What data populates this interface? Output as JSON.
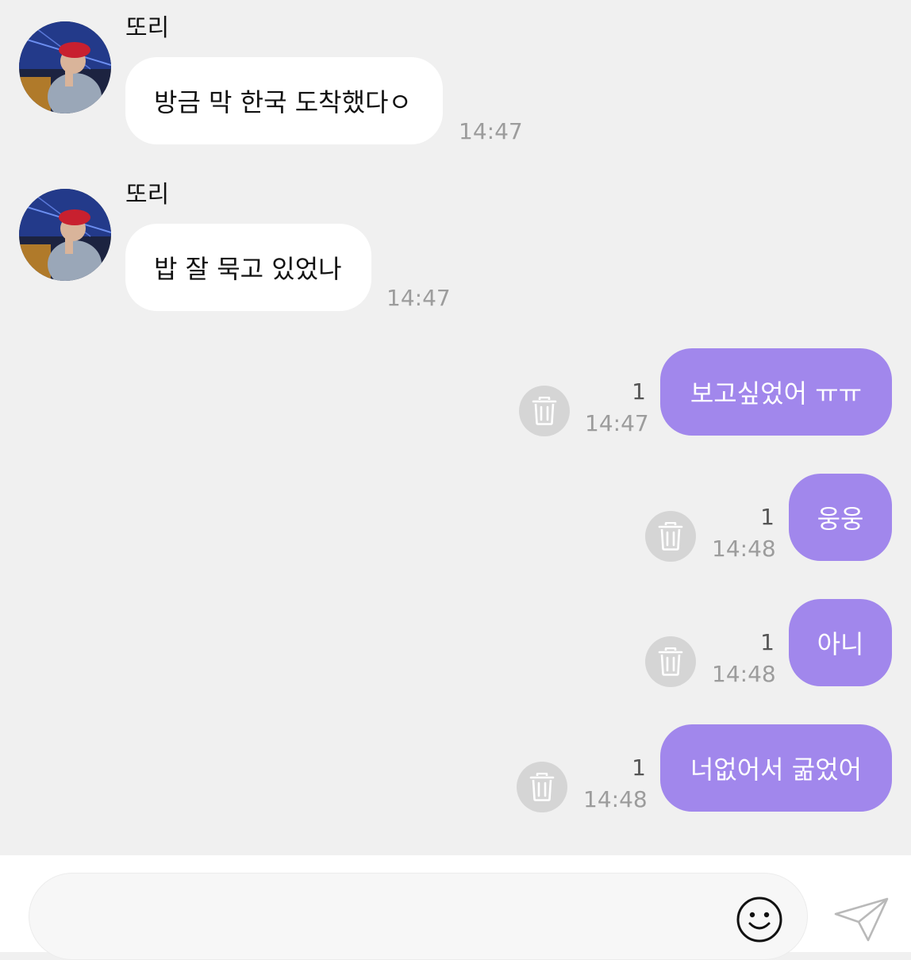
{
  "conversation": {
    "incoming": [
      {
        "sender": "또리",
        "text": "방금 막 한국 도착했다ㅇ",
        "time": "14:47"
      },
      {
        "sender": "또리",
        "text": "밥 잘 묵고 있었나",
        "time": "14:47"
      }
    ],
    "outgoing": [
      {
        "text": "보고싶었어 ㅠㅠ",
        "time": "14:47",
        "unread": "1"
      },
      {
        "text": "웅웅",
        "time": "14:48",
        "unread": "1"
      },
      {
        "text": "아니",
        "time": "14:48",
        "unread": "1"
      },
      {
        "text": "너없어서 굶었어",
        "time": "14:48",
        "unread": "1"
      }
    ]
  },
  "composer": {
    "value": "",
    "emoji_icon": "smiley-face-icon",
    "send_icon": "paper-plane-icon"
  },
  "colors": {
    "background": "#f0f0f0",
    "outgoing_bubble": "#a187ec",
    "incoming_bubble": "#ffffff",
    "timestamp": "#9c9c9c"
  }
}
